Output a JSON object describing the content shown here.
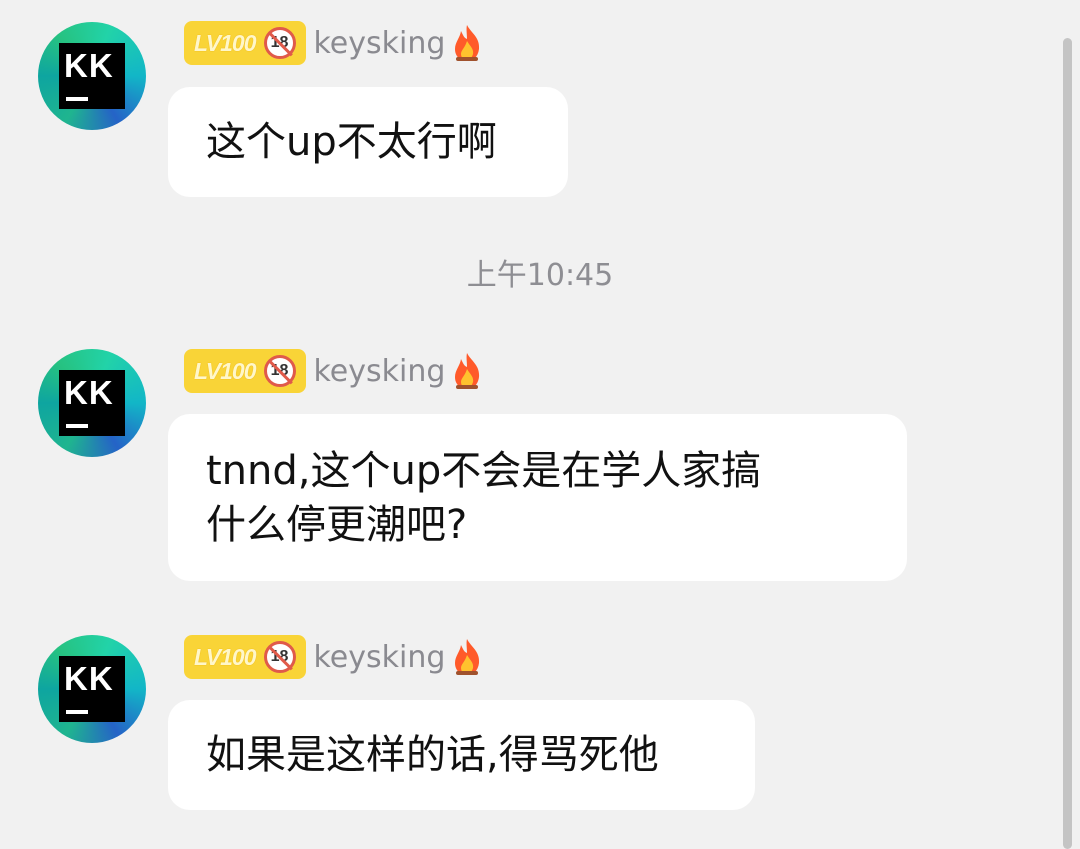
{
  "timestamp": "上午10:45",
  "messages": [
    {
      "level": "LV100",
      "badge_number": "18",
      "username": "keysking",
      "avatar_text": "KK",
      "text_lines": [
        "这个up不太行啊"
      ]
    },
    {
      "level": "LV100",
      "badge_number": "18",
      "username": "keysking",
      "avatar_text": "KK",
      "text_lines": [
        "tnnd,这个up不会是在学人家搞",
        "什么停更潮吧?"
      ]
    },
    {
      "level": "LV100",
      "badge_number": "18",
      "username": "keysking",
      "avatar_text": "KK",
      "text_lines": [
        "如果是这样的话,得骂死他"
      ]
    }
  ],
  "colors": {
    "background": "#f1f1f1",
    "bubble": "#ffffff",
    "level_badge": "#f9d437",
    "username": "#8a8a90",
    "timestamp": "#8e8e93"
  },
  "icons": {
    "fire": "fire-icon",
    "under18": "under-18-icon"
  }
}
